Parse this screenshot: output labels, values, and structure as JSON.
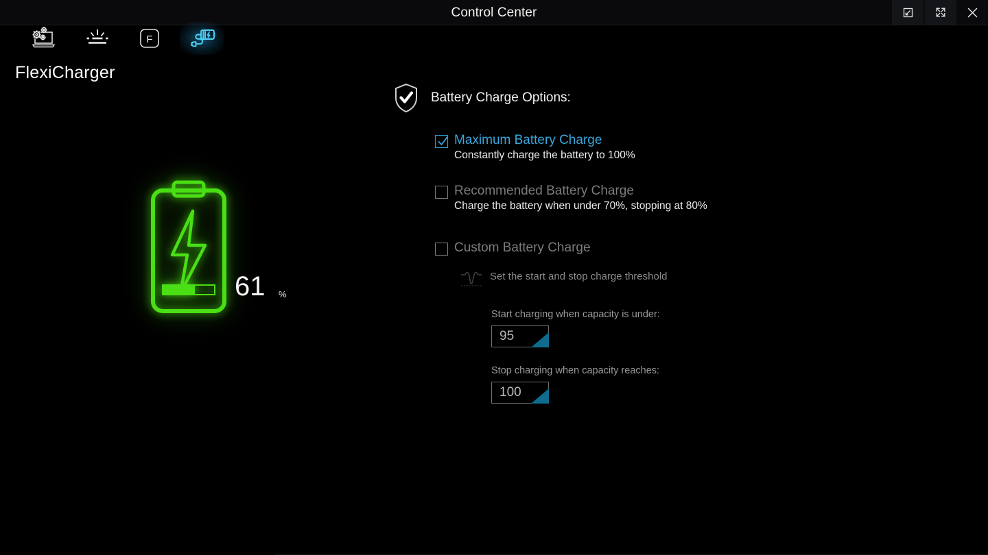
{
  "window": {
    "title": "Control Center",
    "controls": [
      {
        "name": "restore-window-button",
        "icon": "restore-icon",
        "tooltip": "Restore Down"
      },
      {
        "name": "maximize-window-button",
        "icon": "expand-icon",
        "tooltip": "Maximize"
      },
      {
        "name": "close-window-button",
        "icon": "close-icon",
        "tooltip": "Close"
      }
    ]
  },
  "tabs": [
    {
      "id": "system",
      "icon": "laptop-gears-icon",
      "label": "System Settings",
      "active": false
    },
    {
      "id": "backlight",
      "icon": "keyboard-backlight-icon",
      "label": "Keyboard Backlight",
      "active": false
    },
    {
      "id": "fnkeys",
      "icon": "fn-key-icon",
      "label": "Function Keys",
      "active": false
    },
    {
      "id": "charger",
      "icon": "charger-battery-icon",
      "label": "FlexiCharger",
      "active": true
    }
  ],
  "page": {
    "title": "FlexiCharger"
  },
  "battery": {
    "icon": "battery-charging-icon",
    "percent": "61",
    "unit": "%",
    "fill_ratio": 0.61,
    "color": "#4ade14"
  },
  "options": {
    "header_icon": "shield-check-icon",
    "header_label": "Battery Charge Options:",
    "items": [
      {
        "id": "maximum",
        "label": "Maximum Battery Charge",
        "description": "Constantly charge the battery to 100%",
        "checked": true,
        "enabled": true
      },
      {
        "id": "recommended",
        "label": "Recommended Battery Charge",
        "description": "Charge the battery when under 70%, stopping at 80%",
        "checked": false,
        "enabled": false
      },
      {
        "id": "custom",
        "label": "Custom Battery Charge",
        "description": "",
        "checked": false,
        "enabled": false
      }
    ]
  },
  "custom_settings": {
    "threshold_icon": "waveform-threshold-icon",
    "threshold_label": "Set the start and stop charge threshold",
    "start_label": "Start charging when capacity is under:",
    "start_value": "95",
    "stop_label": "Stop charging when capacity reaches:",
    "stop_value": "100"
  },
  "colors": {
    "accent": "#3aa7dd",
    "battery_green": "#4ade14",
    "field_corner": "#106c8e",
    "background": "#000000",
    "titlebar": "#0a0a0c"
  }
}
